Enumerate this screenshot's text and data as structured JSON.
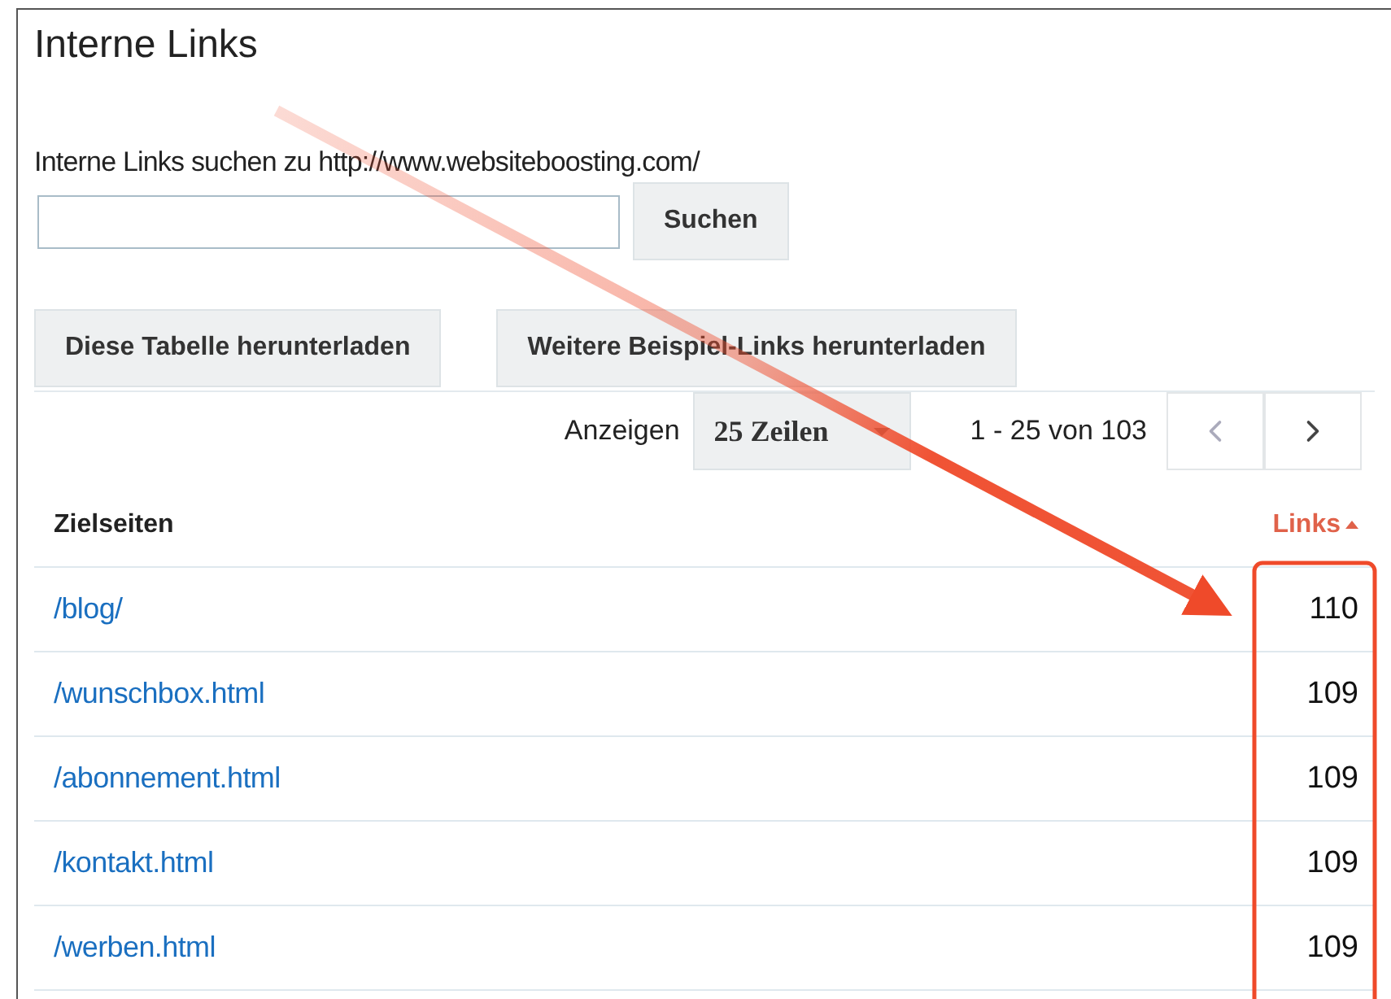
{
  "title": "Interne Links",
  "search": {
    "label": "Interne Links suchen zu http://www.websiteboosting.com/",
    "button": "Suchen"
  },
  "downloads": [
    "Diese Tabelle herunterladen",
    "Weitere Beispiel-Links herunterladen"
  ],
  "pager": {
    "show_label": "Anzeigen",
    "rows_option": "25 Zeilen",
    "range": "1 - 25 von 103",
    "prev_disabled": true,
    "next_disabled": false
  },
  "table": {
    "columns": [
      {
        "label": "Zielseiten",
        "sorted": false
      },
      {
        "label": "Links",
        "sorted": true
      }
    ],
    "rows": [
      {
        "page": "/blog/",
        "links": "110"
      },
      {
        "page": "/wunschbox.html",
        "links": "109"
      },
      {
        "page": "/abonnement.html",
        "links": "109"
      },
      {
        "page": "/kontakt.html",
        "links": "109"
      },
      {
        "page": "/werben.html",
        "links": "109"
      }
    ]
  },
  "annotation": {
    "arrow": true,
    "highlight": true
  }
}
